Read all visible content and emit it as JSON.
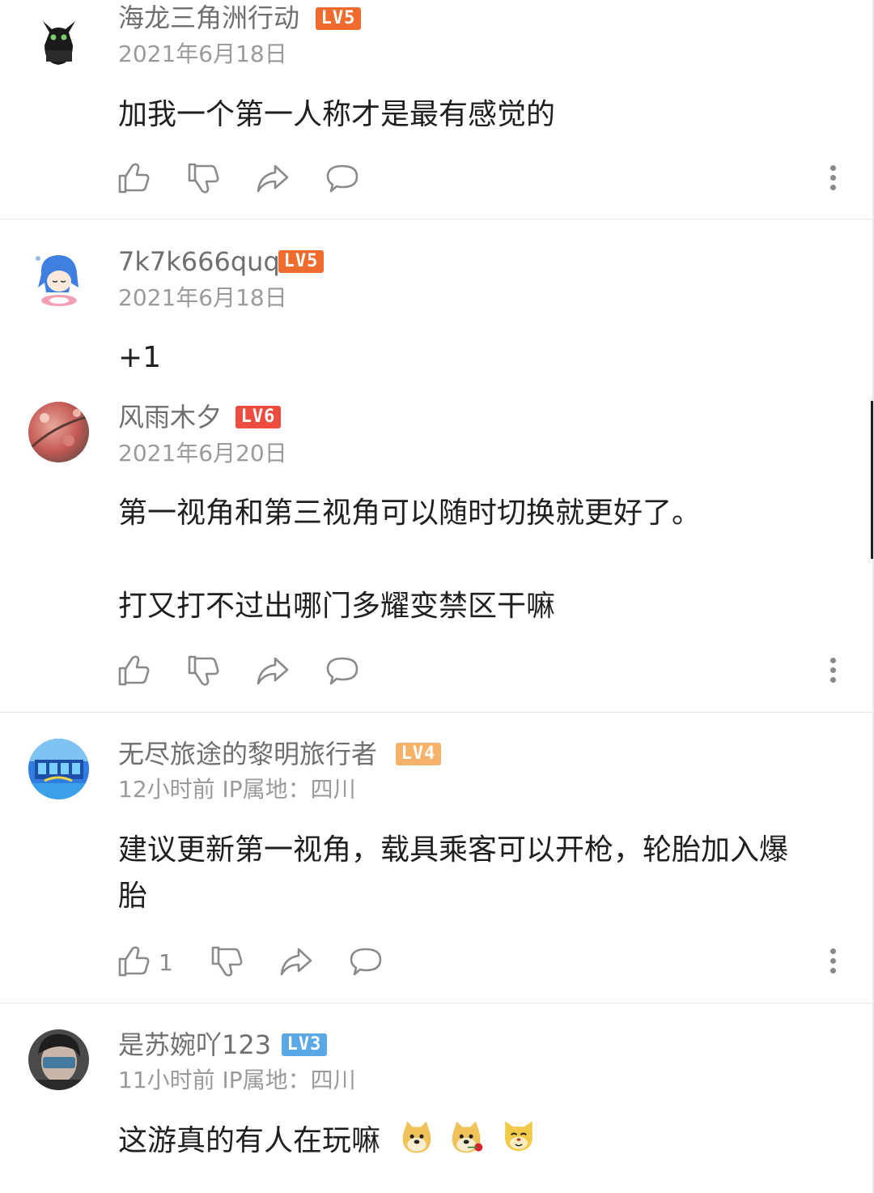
{
  "colors": {
    "lv5": "#ef6c2e",
    "lv6": "#ee4c3f",
    "lv4": "#f7b26a",
    "lv3": "#5aa9e6",
    "username": "#6f6f6f",
    "meta": "#9a9a9a",
    "icon": "#8a8a8a"
  },
  "comments": [
    {
      "username": "海龙三角洲行动",
      "level": "LV5",
      "date": "2021年6月18日",
      "lines": [
        "加我一个第一人称才是最有感觉的"
      ],
      "icons": [
        "thumbs-up-icon",
        "thumbs-down-icon",
        "share-icon",
        "reply-bubble-icon",
        "more-vertical-icon"
      ]
    },
    {
      "username": "7k7k666quq",
      "level": "LV5",
      "date": "2021年6月18日",
      "lines": [
        "+1"
      ]
    },
    {
      "username": "风雨木夕",
      "level": "LV6",
      "date": "2021年6月20日",
      "lines": [
        "第一视角和第三视角可以随时切换就更好了。",
        "打又打不过出哪门多耀变禁区干嘛"
      ]
    },
    {
      "username": "无尽旅途的黎明旅行者",
      "level": "LV4",
      "date": "12小时前  IP属地：四川",
      "lines": [
        "建议更新第一视角，载具乘客可以开枪，轮胎加入爆",
        "胎"
      ],
      "like_count": "1"
    },
    {
      "username": "是苏婉吖123",
      "level": "LV3",
      "date": "11小时前  IP属地：四川",
      "lines": [
        "这游真的有人在玩嘛"
      ],
      "emojis": [
        "doge-emoji",
        "doge-rose-emoji",
        "cat-doge-emoji"
      ]
    }
  ]
}
